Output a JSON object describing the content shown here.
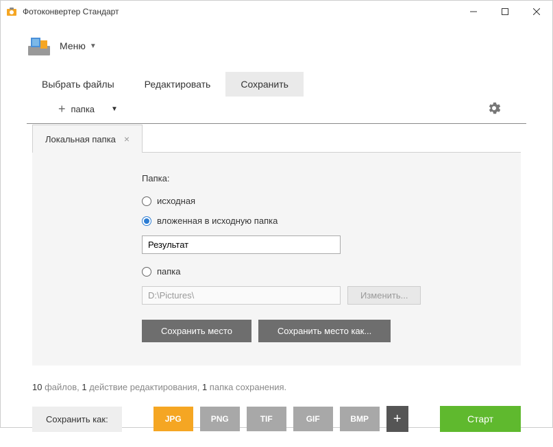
{
  "window": {
    "title": "Фотоконвертер Стандарт"
  },
  "menubar": {
    "menu_label": "Меню"
  },
  "tabs": {
    "select": "Выбрать файлы",
    "edit": "Редактировать",
    "save": "Сохранить"
  },
  "toolbar": {
    "add_folder": "папка"
  },
  "subtab": {
    "local_folder": "Локальная папка"
  },
  "panel": {
    "folder_label": "Папка:",
    "radio_source": "исходная",
    "radio_nested": "вложенная в исходную папка",
    "nested_value": "Результат",
    "radio_folder": "папка",
    "path_value": "D:\\Pictures\\",
    "browse_label": "Изменить...",
    "save_place": "Сохранить место",
    "save_place_as": "Сохранить место как..."
  },
  "status": {
    "files_count": "10",
    "files_word": " файлов,  ",
    "actions_count": "1",
    "actions_word": " действие редактирования,  ",
    "folders_count": "1",
    "folders_word": " папка сохранения."
  },
  "footer": {
    "save_as": "Сохранить как:",
    "formats": {
      "jpg": "JPG",
      "png": "PNG",
      "tif": "TIF",
      "gif": "GIF",
      "bmp": "BMP"
    },
    "start": "Старт"
  }
}
